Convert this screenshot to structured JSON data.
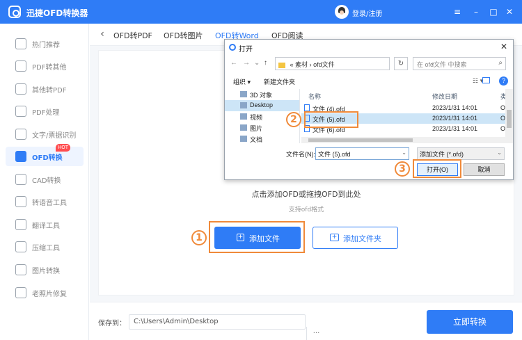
{
  "app": {
    "title": "迅捷OFD转换器",
    "login": "登录/注册",
    "window_controls": {
      "menu": "≡",
      "minimize": "–",
      "maximize": "□",
      "close": "✕"
    }
  },
  "sidebar": {
    "items": [
      {
        "label": "热门推荐",
        "icon": "fire-icon"
      },
      {
        "label": "PDF转其他",
        "icon": "pdf-icon"
      },
      {
        "label": "其他转PDF",
        "icon": "convert-to-pdf-icon"
      },
      {
        "label": "PDF处理",
        "icon": "pdf-process-icon"
      },
      {
        "label": "文字/票据识别",
        "icon": "ocr-icon"
      },
      {
        "label": "OFD转换",
        "icon": "ofd-icon",
        "active": true,
        "badge": "HOT"
      },
      {
        "label": "CAD转换",
        "icon": "cad-icon"
      },
      {
        "label": "转语音工具",
        "icon": "audio-icon"
      },
      {
        "label": "翻译工具",
        "icon": "translate-icon"
      },
      {
        "label": "压缩工具",
        "icon": "compress-icon"
      },
      {
        "label": "图片转换",
        "icon": "image-icon"
      },
      {
        "label": "老照片修复",
        "icon": "photo-restore-icon"
      }
    ]
  },
  "tabs": {
    "back": "‹",
    "items": [
      {
        "label": "OFD转PDF"
      },
      {
        "label": "OFD转图片"
      },
      {
        "label": "OFD转Word",
        "active": true
      },
      {
        "label": "OFD阅读"
      }
    ]
  },
  "main": {
    "drop_hint": "点击添加OFD或拖拽OFD到此处",
    "drop_sub": "支持ofd格式",
    "add_file": "添加文件",
    "add_folder": "添加文件夹"
  },
  "bottom": {
    "save_label": "保存到：",
    "save_path": "C:\\Users\\Admin\\Desktop",
    "browse": "···",
    "convert": "立即转换"
  },
  "callouts": {
    "one": "1",
    "two": "2",
    "three": "3"
  },
  "dialog": {
    "title": "打开",
    "close": "✕",
    "address": [
      "«",
      "素材",
      "›",
      "ofd文件"
    ],
    "search_placeholder": "在 ofd文件 中搜索",
    "toolbar": {
      "organize": "组织 ▾",
      "new_folder": "新建文件夹"
    },
    "tree": [
      {
        "label": "3D 对象"
      },
      {
        "label": "Desktop",
        "selected": true
      },
      {
        "label": "视频"
      },
      {
        "label": "图片"
      },
      {
        "label": "文档"
      }
    ],
    "columns": {
      "name": "名称",
      "modified": "修改日期",
      "type": "类"
    },
    "files": [
      {
        "name": "文件 (4).ofd",
        "date": "2023/1/31 14:01",
        "type": "O"
      },
      {
        "name": "文件 (5).ofd",
        "date": "2023/1/31 14:01",
        "type": "O",
        "selected": true
      },
      {
        "name": "文件 (6).ofd",
        "date": "2023/1/31 14:01",
        "type": "O"
      }
    ],
    "filename_label": "文件名(N):",
    "filename_value": "文件 (5).ofd",
    "filetype_value": "添加文件 (*.ofd)",
    "open_button": "打开(O)",
    "cancel_button": "取消"
  },
  "colors": {
    "accent": "#2f7cf6",
    "callout": "#f08a3a",
    "hot": "#ff4d4f"
  }
}
